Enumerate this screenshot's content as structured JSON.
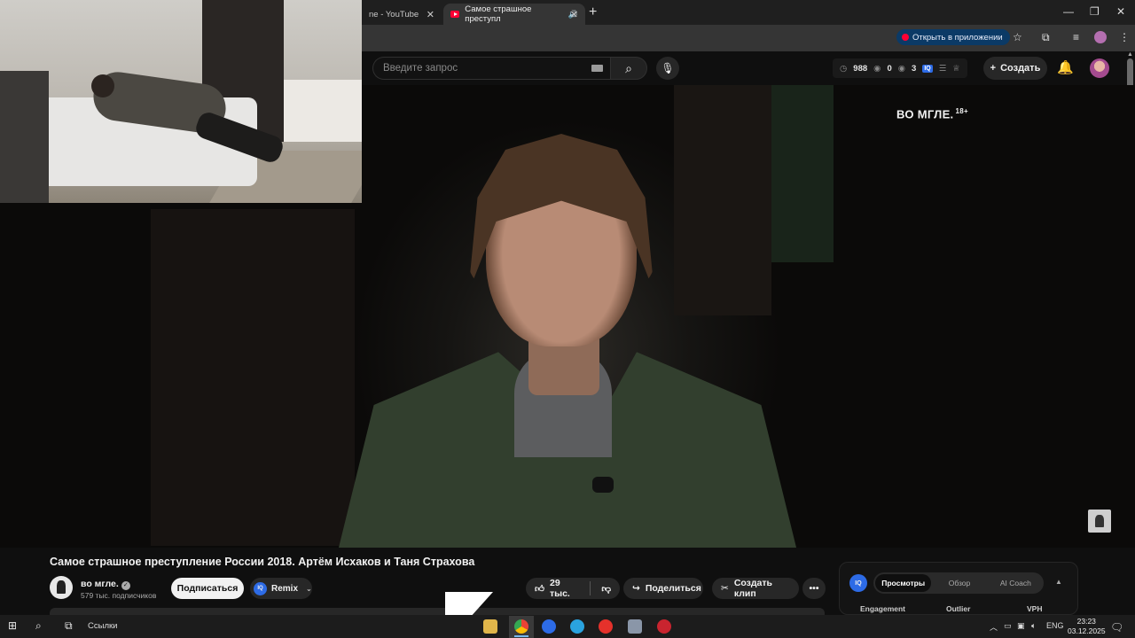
{
  "browser": {
    "tabs": [
      {
        "title": "ne - YouTube"
      },
      {
        "title": "Самое страшное преступл"
      }
    ],
    "open_in_app": "Открыть в приложении"
  },
  "youtube": {
    "search_placeholder": "Введите запрос",
    "stats": {
      "views": "988",
      "likes": "0",
      "comments": "3",
      "iq_label": "IQ"
    },
    "create_label": "Создать"
  },
  "video": {
    "watermark": "ВО МГЛЕ.",
    "age_rating": "18+",
    "title": "Самое страшное преступление России 2018. Артём Исхаков и Таня Страхова"
  },
  "channel": {
    "name": "во мгле.",
    "subscribers": "579 тыс. подписчиков",
    "subscribe_label": "Подписаться",
    "remix_label": "Remix"
  },
  "actions": {
    "likes": "29 тыс.",
    "share_label": "Поделиться",
    "clip_label": "Создать клип"
  },
  "analytics": {
    "tabs": [
      "Просмотры",
      "Обзор",
      "AI Coach"
    ],
    "columns": [
      "Engagement",
      "Outlier",
      "VPH"
    ],
    "iq_label": "IQ"
  },
  "taskbar": {
    "links_label": "Ссылки",
    "language": "ENG",
    "time": "23:23",
    "date": "03.12.2025"
  },
  "colors": {
    "youtube_red": "#ff0033",
    "accent_blue": "#2d6be6",
    "background": "#0f0f0f"
  }
}
